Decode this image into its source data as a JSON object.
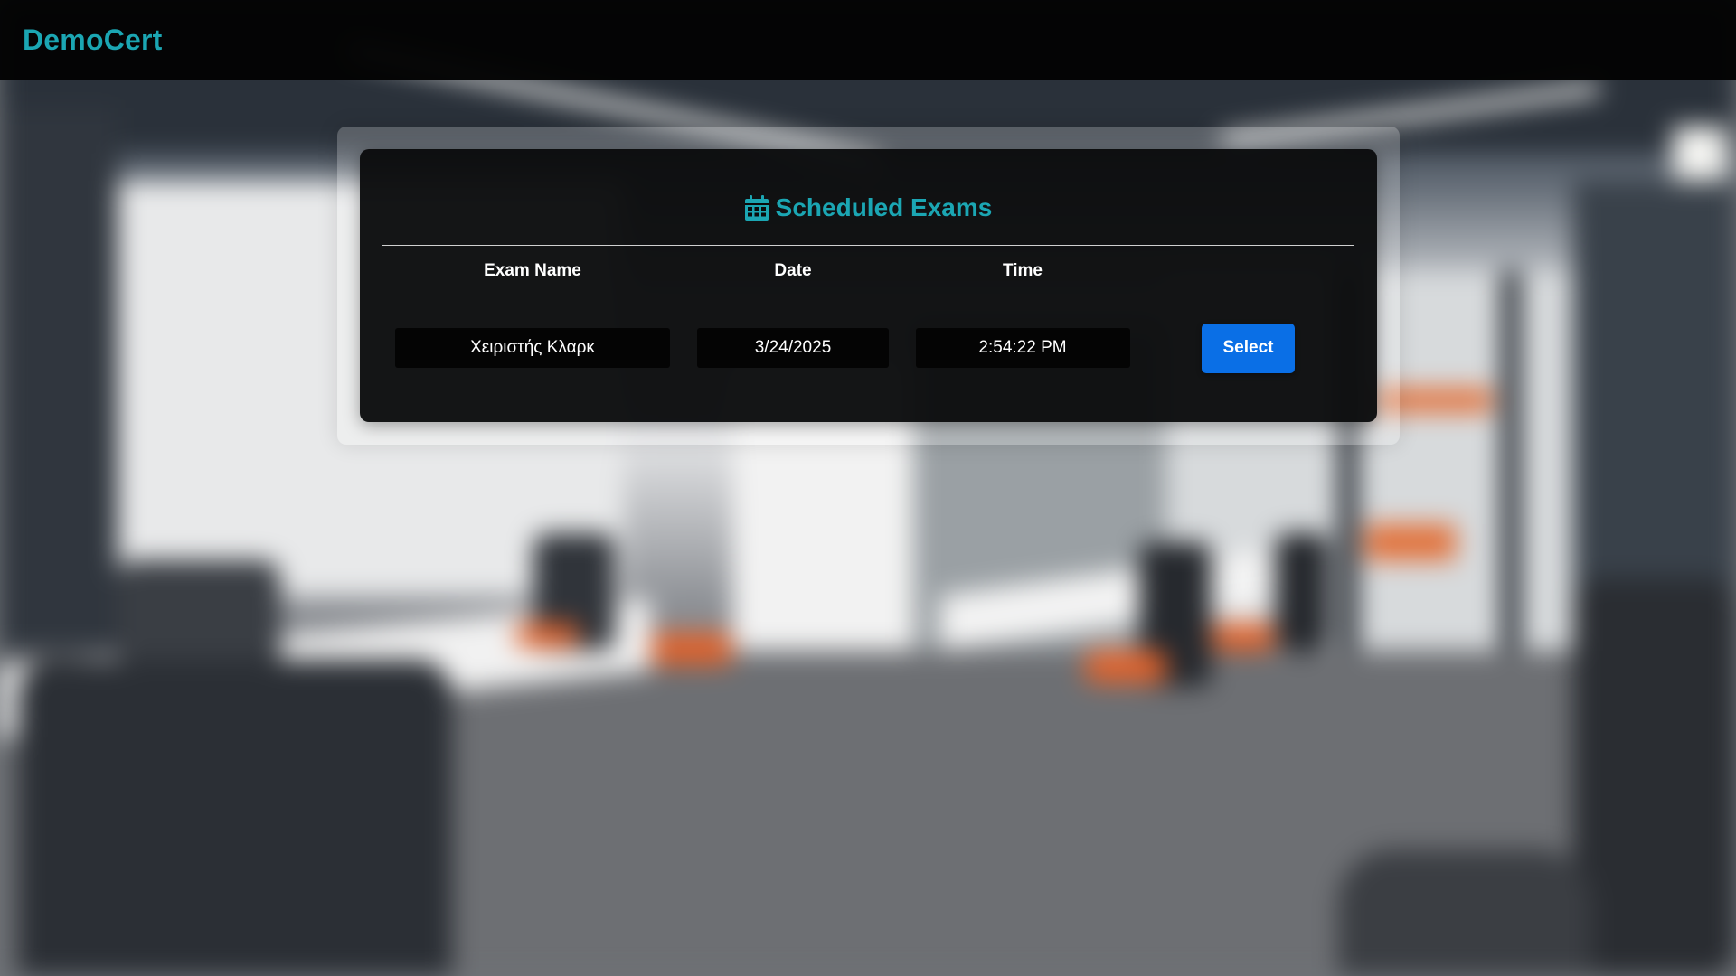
{
  "navbar": {
    "brand": "DemoCert"
  },
  "exams_panel": {
    "title": "Scheduled Exams",
    "title_icon": "calendar-icon",
    "columns": [
      "Exam Name",
      "Date",
      "Time",
      ""
    ],
    "rows": [
      {
        "exam_name": "Χειριστής Κλαρκ",
        "date": "3/24/2025",
        "time": "2:54:22 PM",
        "action_label": "Select"
      }
    ]
  },
  "colors": {
    "brand_accent": "#1ba6b3",
    "primary_button": "#0a6fe6",
    "card_background": "#0a0b0c",
    "navbar_background": "#030303"
  }
}
